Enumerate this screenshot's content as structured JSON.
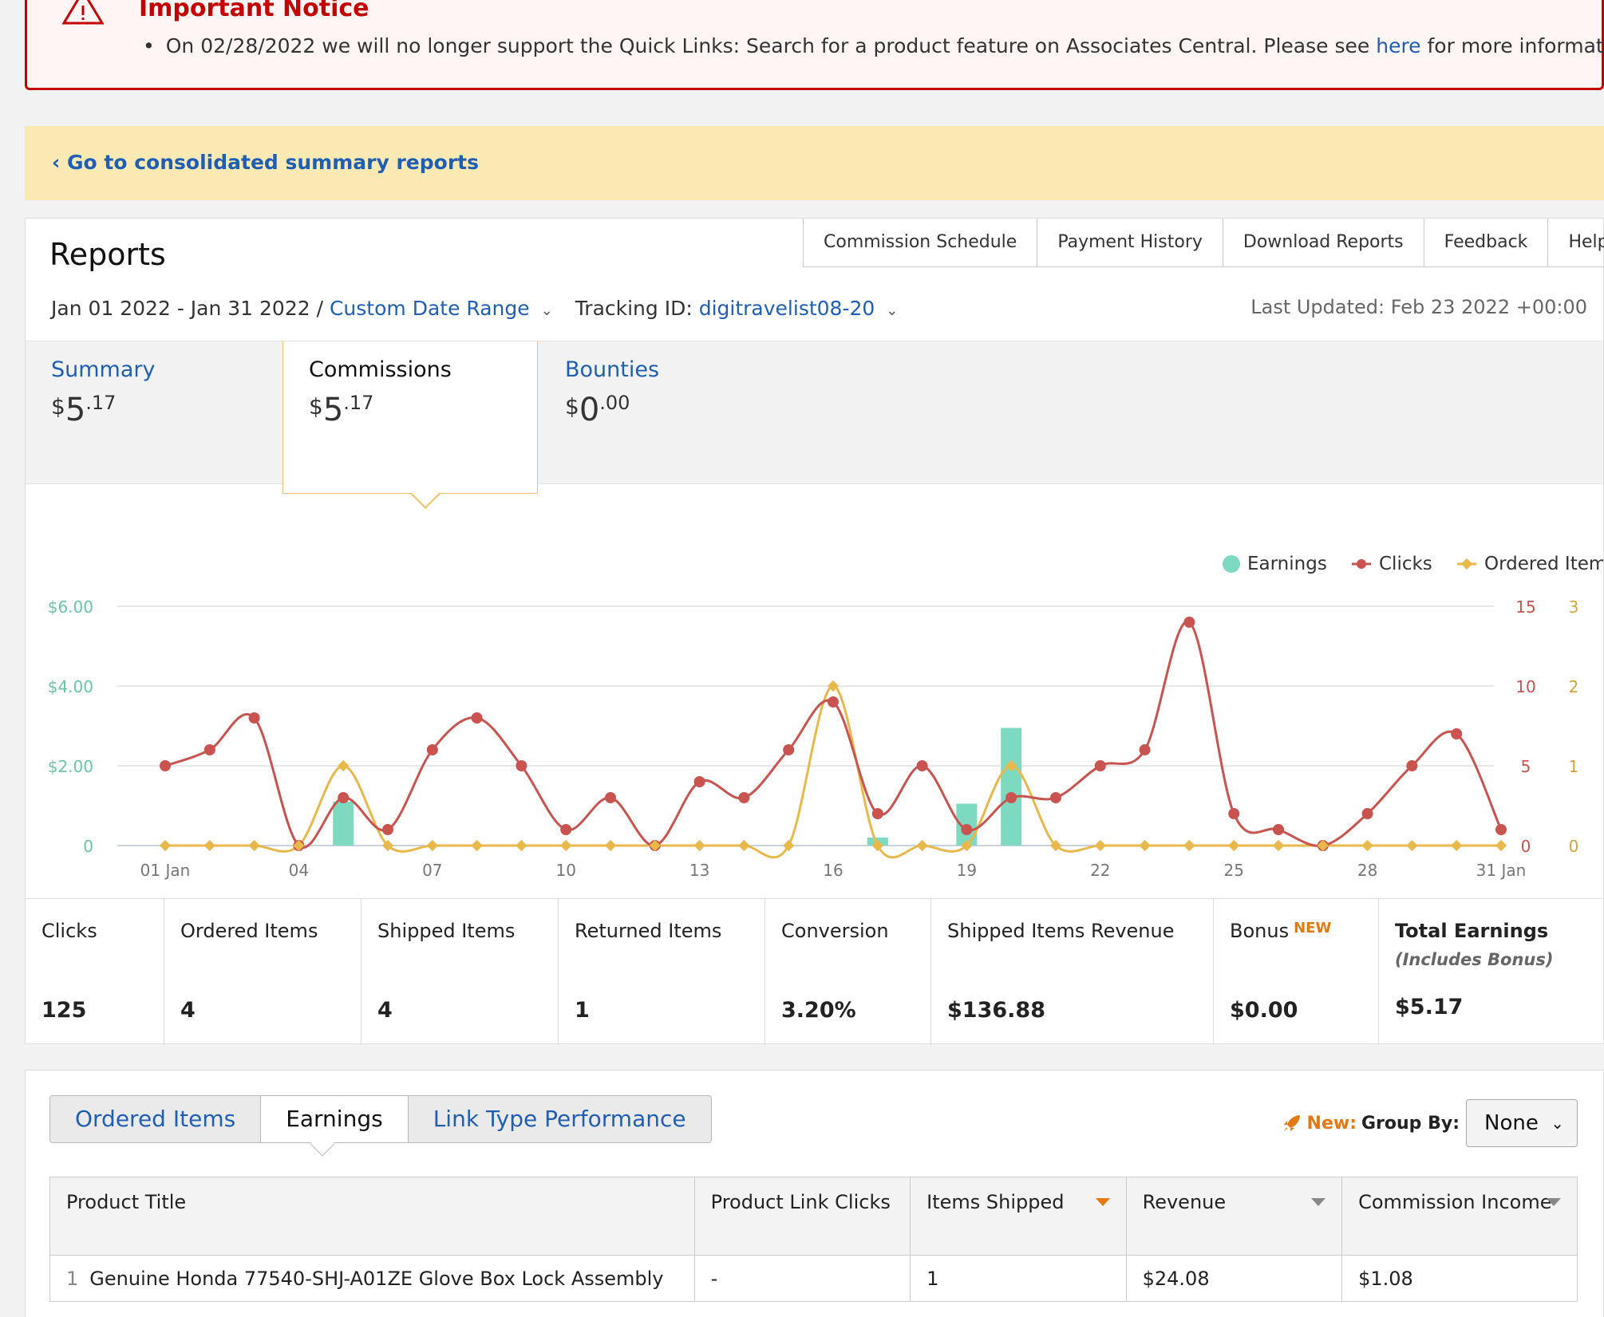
{
  "notice": {
    "title": "Important Notice",
    "bullet": "•",
    "message_before": "On 02/28/2022 we will no longer support the Quick Links: Search for a product feature on Associates Central. Please see ",
    "link": "here",
    "message_after": " for more information."
  },
  "back_link": "‹ Go to consolidated summary reports",
  "reports": {
    "title": "Reports",
    "nav": [
      "Commission Schedule",
      "Payment History",
      "Download Reports",
      "Feedback",
      "Help"
    ],
    "date_range": "Jan 01 2022 - Jan 31 2022 /",
    "custom_range": "Custom Date Range",
    "tracking_label": "Tracking ID:",
    "tracking_id": "digitravelist08-20",
    "last_updated": "Last Updated: Feb 23 2022 +00:00",
    "tabs": [
      {
        "label": "Summary",
        "currency": "$",
        "whole": "5",
        "cents": ".17"
      },
      {
        "label": "Commissions",
        "currency": "$",
        "whole": "5",
        "cents": ".17"
      },
      {
        "label": "Bounties",
        "currency": "$",
        "whole": "0",
        "cents": ".00"
      }
    ]
  },
  "chart_data": {
    "type": "line",
    "legend": [
      "Earnings",
      "Clicks",
      "Ordered Items"
    ],
    "legend_position": "top-right",
    "colors": {
      "earnings": "#7dd9c0",
      "clicks": "#c9534e",
      "ordered": "#e8b84a"
    },
    "x_ticks": [
      "01 Jan",
      "04",
      "07",
      "10",
      "13",
      "16",
      "19",
      "22",
      "25",
      "28",
      "31 Jan"
    ],
    "left_ticks": [
      "0",
      "$2.00",
      "$4.00",
      "$6.00"
    ],
    "right_ticks_clicks": [
      "0",
      "5",
      "10",
      "15"
    ],
    "right_ticks_items": [
      "0",
      "1",
      "2",
      "3"
    ],
    "left_range": [
      0,
      6
    ],
    "clicks_range": [
      0,
      15
    ],
    "items_range": [
      0,
      3
    ],
    "grid": true,
    "days": [
      1,
      2,
      3,
      4,
      5,
      6,
      7,
      8,
      9,
      10,
      11,
      12,
      13,
      14,
      15,
      16,
      17,
      18,
      19,
      20,
      21,
      22,
      23,
      24,
      25,
      26,
      27,
      28,
      29,
      30,
      31
    ],
    "series": [
      {
        "name": "Clicks",
        "values": [
          5,
          6,
          8,
          0,
          3,
          1,
          6,
          8,
          5,
          1,
          3,
          0,
          4,
          3,
          6,
          9,
          2,
          5,
          1,
          3,
          3,
          5,
          6,
          14,
          2,
          1,
          0,
          2,
          5,
          7,
          1
        ]
      },
      {
        "name": "Ordered Items",
        "values": [
          0,
          0,
          0,
          0,
          1,
          0,
          0,
          0,
          0,
          0,
          0,
          0,
          0,
          0,
          0,
          2,
          0,
          0,
          0,
          1,
          0,
          0,
          0,
          0,
          0,
          0,
          0,
          0,
          0,
          0,
          0
        ]
      },
      {
        "name": "Earnings",
        "values": [
          0,
          0,
          0,
          0,
          1.1,
          0,
          0,
          0,
          0,
          0,
          0,
          0,
          0,
          0,
          0,
          0,
          0.2,
          0,
          1.05,
          2.95,
          0,
          0,
          0,
          0,
          0,
          0,
          0,
          0,
          0,
          0,
          0
        ]
      }
    ]
  },
  "stats": [
    {
      "label": "Clicks",
      "value": "125"
    },
    {
      "label": "Ordered Items",
      "value": "4"
    },
    {
      "label": "Shipped Items",
      "value": "4"
    },
    {
      "label": "Returned Items",
      "value": "1"
    },
    {
      "label": "Conversion",
      "value": "3.20%"
    },
    {
      "label": "Shipped Items Revenue",
      "value": "$136.88"
    },
    {
      "label": "Bonus",
      "tag": "NEW",
      "value": "$0.00"
    },
    {
      "label": "Total Earnings",
      "sub": "(Includes Bonus)",
      "value": "$5.17"
    }
  ],
  "lower": {
    "tabs": [
      "Ordered Items",
      "Earnings",
      "Link Type Performance"
    ],
    "new_label": "New:",
    "group_by_label": "Group By:",
    "group_by_value": "None",
    "columns": [
      "Product Title",
      "Product Link Clicks",
      "Items Shipped",
      "Revenue",
      "Commission Income"
    ],
    "rows": [
      {
        "num": "1",
        "title": "Genuine Honda 77540-SHJ-A01ZE Glove Box Lock Assembly",
        "clicks": "-",
        "shipped": "1",
        "revenue": "$24.08",
        "commission": "$1.08"
      }
    ]
  }
}
